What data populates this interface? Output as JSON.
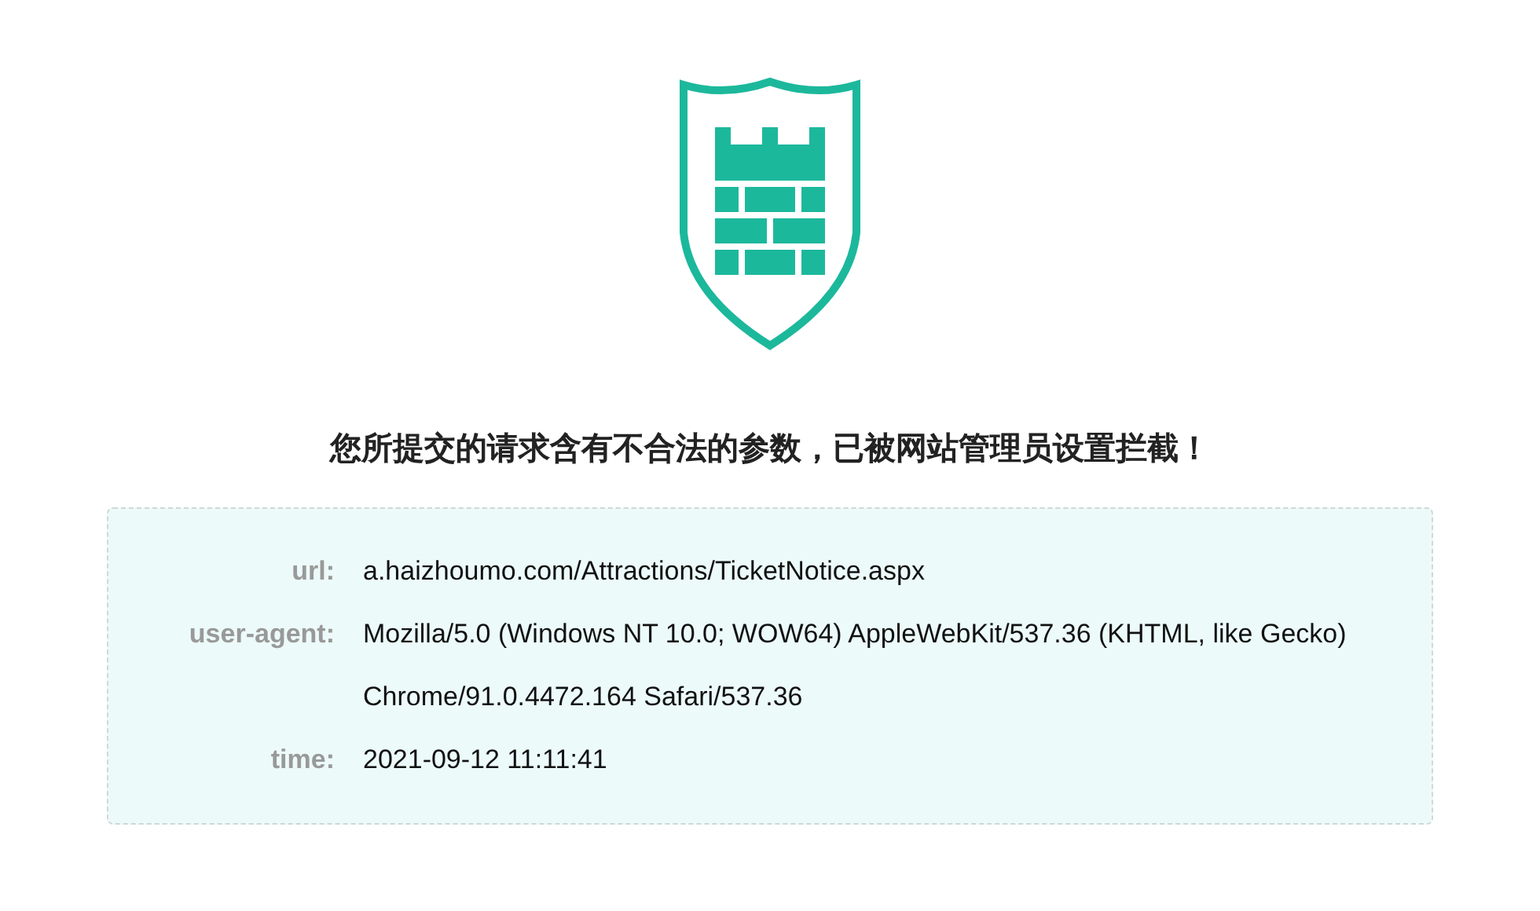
{
  "heading": "您所提交的请求含有不合法的参数，已被网站管理员设置拦截！",
  "details": [
    {
      "label": "url:",
      "value": "a.haizhoumo.com/Attractions/TicketNotice.aspx"
    },
    {
      "label": "user-agent:",
      "value": "Mozilla/5.0 (Windows NT 10.0; WOW64) AppleWebKit/537.36 (KHTML, like Gecko) Chrome/91.0.4472.164 Safari/537.36"
    },
    {
      "label": "time:",
      "value": "2021-09-12 11:11:41"
    }
  ]
}
